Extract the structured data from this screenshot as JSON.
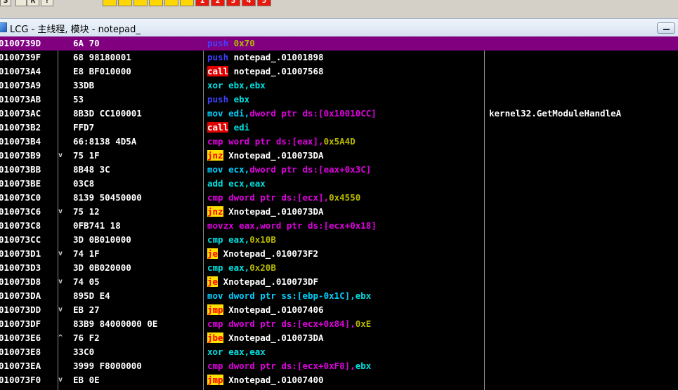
{
  "toolbar": {
    "buttons": [
      "S",
      "",
      "K",
      "?",
      "",
      "",
      "",
      "",
      "",
      "",
      "1",
      "2",
      "3",
      "4",
      "5"
    ]
  },
  "window": {
    "title": "LCG - 主线程, 模块 - notepad_"
  },
  "rows": [
    {
      "addr": "0100739D",
      "mark": "",
      "hex": "6A 70",
      "tokens": [
        [
          "push",
          "t-push"
        ],
        [
          " 0x70",
          "t-imm"
        ]
      ],
      "comment": "",
      "selected": true
    },
    {
      "addr": "0100739F",
      "mark": "",
      "hex": "68 98180001",
      "tokens": [
        [
          "push",
          "t-push"
        ],
        [
          " notepad_.01001898",
          "t-sym"
        ]
      ],
      "comment": "",
      "selected": false
    },
    {
      "addr": "010073A4",
      "mark": "",
      "hex": "E8 BF010000",
      "tokens": [
        [
          "call",
          "t-call"
        ],
        [
          " notepad_.01007568",
          "t-sym"
        ]
      ],
      "comment": "",
      "selected": false
    },
    {
      "addr": "010073A9",
      "mark": "",
      "hex": "33DB",
      "tokens": [
        [
          "xor",
          "t-xor"
        ],
        [
          " ebx,ebx",
          "t-xor"
        ]
      ],
      "comment": "",
      "selected": false
    },
    {
      "addr": "010073AB",
      "mark": "",
      "hex": "53",
      "tokens": [
        [
          "push",
          "t-push"
        ],
        [
          " ebx",
          "t-xor"
        ]
      ],
      "comment": "",
      "selected": false
    },
    {
      "addr": "010073AC",
      "mark": "",
      "hex": "8B3D CC100001",
      "tokens": [
        [
          "mov",
          "t-mov"
        ],
        [
          " edi,",
          "t-mov"
        ],
        [
          "dword ptr ds:[0x10010CC]",
          "t-mem"
        ]
      ],
      "comment": "kernel32.GetModuleHandleA",
      "selected": false
    },
    {
      "addr": "010073B2",
      "mark": "",
      "hex": "FFD7",
      "tokens": [
        [
          "call",
          "t-call"
        ],
        [
          " edi",
          "t-xor"
        ]
      ],
      "comment": "",
      "selected": false
    },
    {
      "addr": "010073B4",
      "mark": "",
      "hex": "66:8138 4D5A",
      "tokens": [
        [
          "cmp",
          "t-cmp"
        ],
        [
          " word ptr ds:[eax],",
          "t-mem"
        ],
        [
          "0x5A4D",
          "t-imm"
        ]
      ],
      "comment": "",
      "selected": false
    },
    {
      "addr": "010073B9",
      "mark": "v",
      "hex": "75 1F",
      "tokens": [
        [
          "jnz",
          "t-jcc"
        ],
        [
          " Xnotepad_.010073DA",
          "t-sym"
        ]
      ],
      "comment": "",
      "selected": false
    },
    {
      "addr": "010073BB",
      "mark": "",
      "hex": "8B48 3C",
      "tokens": [
        [
          "mov",
          "t-mov"
        ],
        [
          " ecx,",
          "t-mov"
        ],
        [
          "dword ptr ds:[eax+0x3C]",
          "t-mem"
        ]
      ],
      "comment": "",
      "selected": false
    },
    {
      "addr": "010073BE",
      "mark": "",
      "hex": "03C8",
      "tokens": [
        [
          "add",
          "t-xor"
        ],
        [
          " ecx,eax",
          "t-xor"
        ]
      ],
      "comment": "",
      "selected": false
    },
    {
      "addr": "010073C0",
      "mark": "",
      "hex": "8139 50450000",
      "tokens": [
        [
          "cmp",
          "t-cmp"
        ],
        [
          " dword ptr ds:[ecx],",
          "t-mem"
        ],
        [
          "0x4550",
          "t-imm"
        ]
      ],
      "comment": "",
      "selected": false
    },
    {
      "addr": "010073C6",
      "mark": "v",
      "hex": "75 12",
      "tokens": [
        [
          "jnz",
          "t-jcc"
        ],
        [
          " Xnotepad_.010073DA",
          "t-sym"
        ]
      ],
      "comment": "",
      "selected": false
    },
    {
      "addr": "010073C8",
      "mark": "",
      "hex": "0FB741 18",
      "tokens": [
        [
          "movzx",
          "t-mnx"
        ],
        [
          " eax,",
          "t-mnx"
        ],
        [
          "word ptr ds:[ecx+0x18]",
          "t-mem"
        ]
      ],
      "comment": "",
      "selected": false
    },
    {
      "addr": "010073CC",
      "mark": "",
      "hex": "3D 0B010000",
      "tokens": [
        [
          "cmp",
          "t-xor"
        ],
        [
          " eax,",
          "t-xor"
        ],
        [
          "0x10B",
          "t-imm"
        ]
      ],
      "comment": "",
      "selected": false
    },
    {
      "addr": "010073D1",
      "mark": "v",
      "hex": "74 1F",
      "tokens": [
        [
          "je",
          "t-jcc"
        ],
        [
          " Xnotepad_.010073F2",
          "t-sym"
        ]
      ],
      "comment": "",
      "selected": false
    },
    {
      "addr": "010073D3",
      "mark": "",
      "hex": "3D 0B020000",
      "tokens": [
        [
          "cmp",
          "t-xor"
        ],
        [
          " eax,",
          "t-xor"
        ],
        [
          "0x20B",
          "t-imm"
        ]
      ],
      "comment": "",
      "selected": false
    },
    {
      "addr": "010073D8",
      "mark": "v",
      "hex": "74 05",
      "tokens": [
        [
          "je",
          "t-jcc"
        ],
        [
          " Xnotepad_.010073DF",
          "t-sym"
        ]
      ],
      "comment": "",
      "selected": false
    },
    {
      "addr": "010073DA",
      "mark": "",
      "hex": "895D E4",
      "tokens": [
        [
          "mov",
          "t-mov"
        ],
        [
          " dword ptr ss:[ebp-0x1C],",
          "t-mov"
        ],
        [
          "ebx",
          "t-xor"
        ]
      ],
      "comment": "",
      "selected": false
    },
    {
      "addr": "010073DD",
      "mark": "v",
      "hex": "EB 27",
      "tokens": [
        [
          "jmp",
          "t-jmp"
        ],
        [
          " Xnotepad_.01007406",
          "t-sym"
        ]
      ],
      "comment": "",
      "selected": false
    },
    {
      "addr": "010073DF",
      "mark": "",
      "hex": "83B9 84000000 0E",
      "tokens": [
        [
          "cmp",
          "t-cmp"
        ],
        [
          " dword ptr ds:[ecx+0x84],",
          "t-mem"
        ],
        [
          "0xE",
          "t-imm"
        ]
      ],
      "comment": "",
      "selected": false
    },
    {
      "addr": "010073E6",
      "mark": "^",
      "hex": "76 F2",
      "tokens": [
        [
          "jbe",
          "t-jcc"
        ],
        [
          " Xnotepad_.010073DA",
          "t-sym"
        ]
      ],
      "comment": "",
      "selected": false
    },
    {
      "addr": "010073E8",
      "mark": "",
      "hex": "33C0",
      "tokens": [
        [
          "xor",
          "t-xor"
        ],
        [
          " eax,eax",
          "t-xor"
        ]
      ],
      "comment": "",
      "selected": false
    },
    {
      "addr": "010073EA",
      "mark": "",
      "hex": "3999 F8000000",
      "tokens": [
        [
          "cmp",
          "t-cmp"
        ],
        [
          " dword ptr ds:[ecx+0xF8],",
          "t-mem"
        ],
        [
          "ebx",
          "t-xor"
        ]
      ],
      "comment": "",
      "selected": false
    },
    {
      "addr": "010073F0",
      "mark": "v",
      "hex": "EB 0E",
      "tokens": [
        [
          "jmp",
          "t-jmp"
        ],
        [
          " Xnotepad_.01007400",
          "t-sym"
        ]
      ],
      "comment": "",
      "selected": false
    }
  ]
}
